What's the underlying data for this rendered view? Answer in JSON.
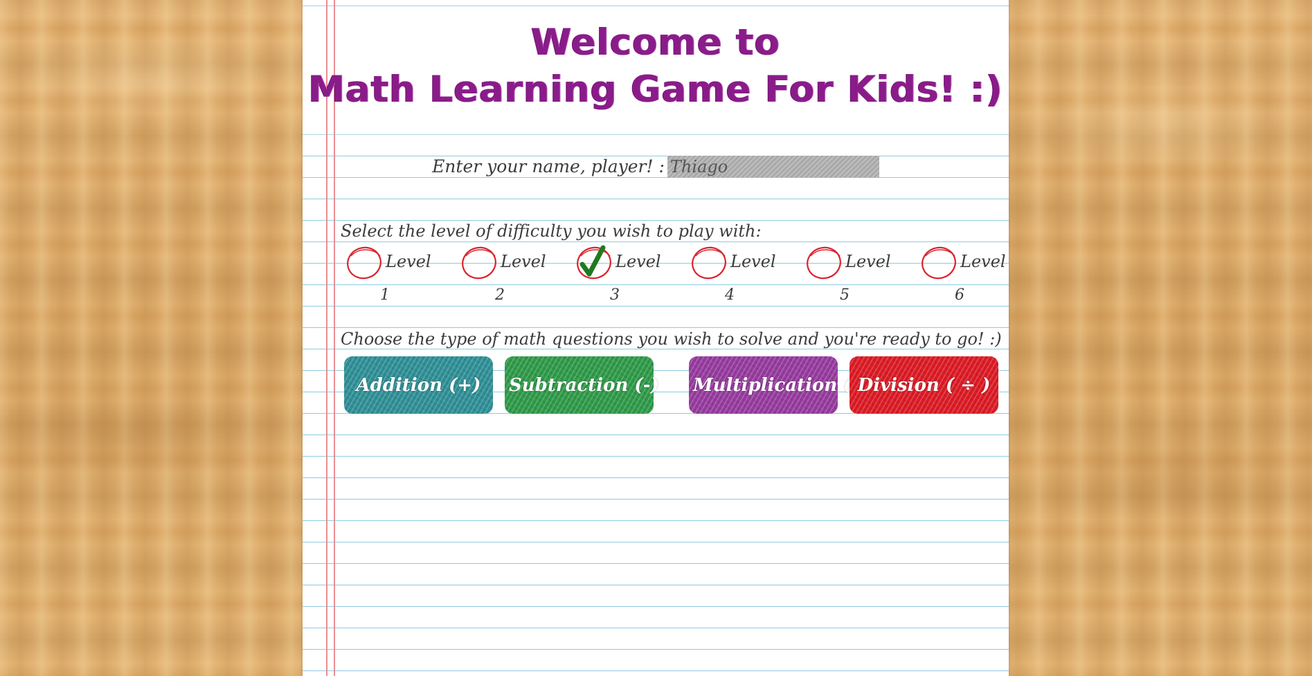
{
  "title": {
    "line1": "Welcome to",
    "line2": "Math Learning Game For Kids! :)"
  },
  "name": {
    "label": "Enter your name, player! :",
    "value": "Thiago"
  },
  "difficulty": {
    "label": "Select the level of difficulty you wish to play with:",
    "selected_level": 3,
    "levels": [
      {
        "word": "Level",
        "number": "1",
        "checked": false
      },
      {
        "word": "Level",
        "number": "2",
        "checked": false
      },
      {
        "word": "Level",
        "number": "3",
        "checked": true
      },
      {
        "word": "Level",
        "number": "4",
        "checked": false
      },
      {
        "word": "Level",
        "number": "5",
        "checked": false
      },
      {
        "word": "Level",
        "number": "6",
        "checked": false
      }
    ]
  },
  "operations": {
    "label": "Choose the type of math questions you wish to solve and you're ready to go! :)",
    "buttons": [
      {
        "label": "Addition (+)",
        "color": "#2e8f96"
      },
      {
        "label": "Subtraction (-)",
        "color": "#2e9a48"
      },
      {
        "label": "Multiplication (X)",
        "color": "#963a9e"
      },
      {
        "label": "Division ( ÷ )",
        "color": "#dc1a24"
      }
    ]
  },
  "colors": {
    "title": "#8a1c8a",
    "circle": "#d9242f",
    "check": "#1f7a1f",
    "wood": "#e4b476"
  }
}
